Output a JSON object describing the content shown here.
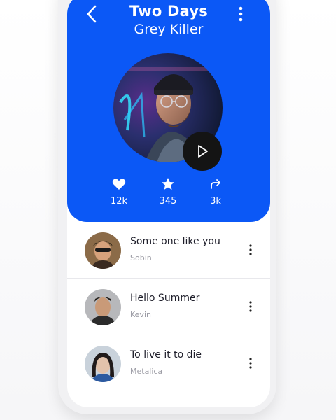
{
  "player": {
    "title": "Two Days",
    "artist": "Grey Killer",
    "stats": {
      "likes": "12k",
      "stars": "345",
      "shares": "3k"
    }
  },
  "tracks": [
    {
      "title": "Some one like you",
      "artist": "Sobin"
    },
    {
      "title": "Hello Summer",
      "artist": "Kevin"
    },
    {
      "title": "To live it to die",
      "artist": "Metalica"
    }
  ],
  "colors": {
    "accent": "#0b58f6",
    "play_button": "#141414",
    "list_text": "#1e1e2a",
    "secondary_text": "#9a9aa3"
  },
  "icons": [
    "back-chevron-icon",
    "more-vertical-icon",
    "play-icon",
    "heart-icon",
    "star-icon",
    "share-icon"
  ]
}
